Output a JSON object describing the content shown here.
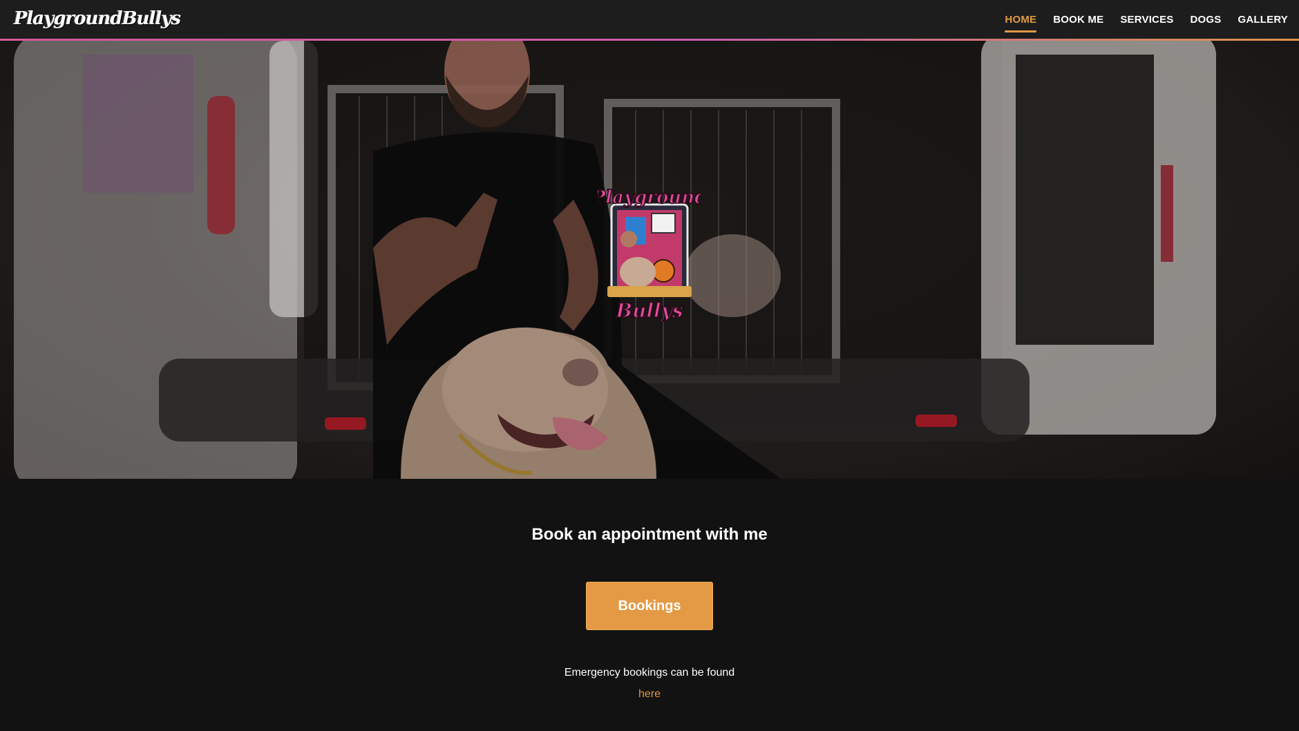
{
  "header": {
    "logo_text": "PlaygroundBullys",
    "nav": [
      {
        "label": "HOME",
        "active": true
      },
      {
        "label": "BOOK ME",
        "active": false
      },
      {
        "label": "SERVICES",
        "active": false
      },
      {
        "label": "DOGS",
        "active": false
      },
      {
        "label": "GALLERY",
        "active": false
      }
    ]
  },
  "hero": {
    "badge_top_text": "Playground",
    "badge_bottom_text": "Bullys"
  },
  "booking": {
    "title": "Book an appointment with me",
    "button_label": "Bookings",
    "emergency_text": "Emergency bookings can be found",
    "here_link": "here"
  },
  "colors": {
    "accent": "#e09a45",
    "header_bg": "#1d1d1d",
    "page_bg": "#121212",
    "gradient_pink": "#d8589a"
  }
}
